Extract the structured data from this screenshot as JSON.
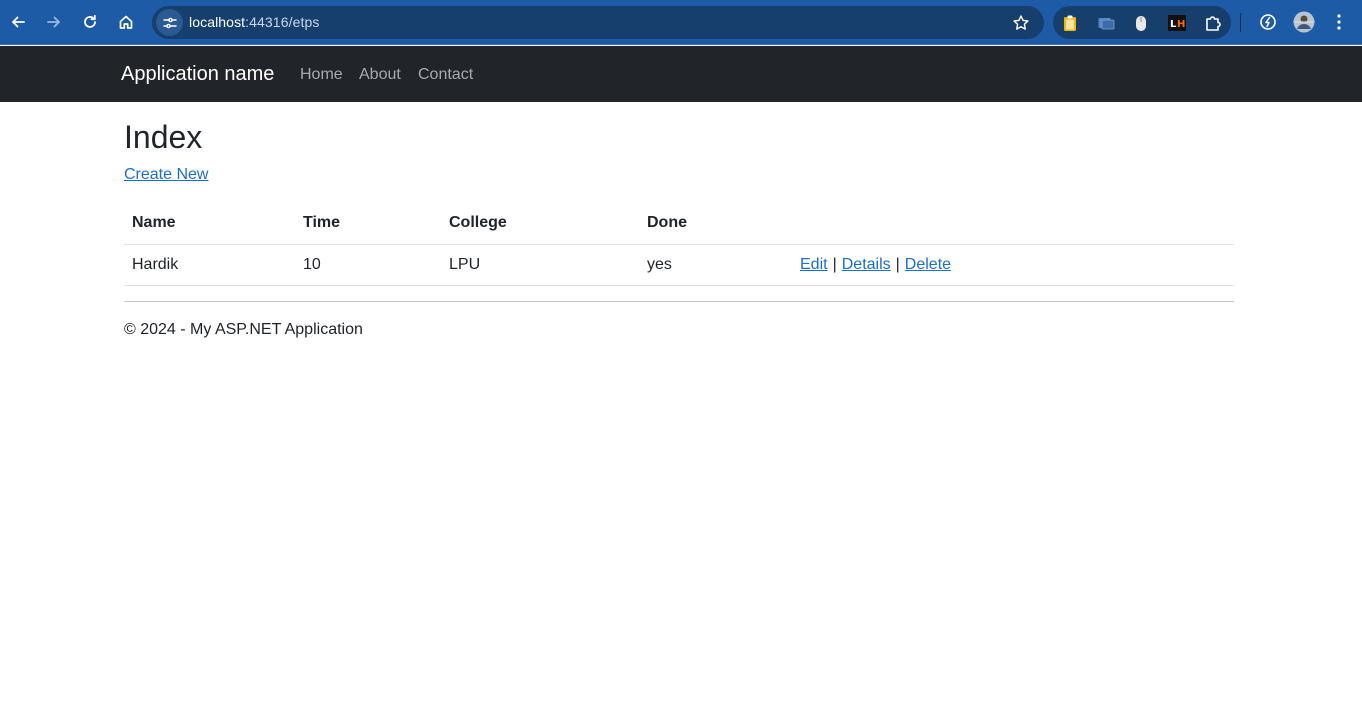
{
  "browser": {
    "url_host": "localhost",
    "url_rest": ":44316/etps",
    "theme_color": "#1d5ba7",
    "extensions": [
      "clipboard-extension-icon",
      "tab-extension-icon",
      "mouse-extension-icon",
      "lighthouse-extension-icon",
      "extensions-puzzle-icon"
    ]
  },
  "navbar": {
    "brand": "Application name",
    "links": [
      "Home",
      "About",
      "Contact"
    ],
    "background": "#212529"
  },
  "page": {
    "title": "Index",
    "create_link": "Create New"
  },
  "table": {
    "headers": [
      "Name",
      "Time",
      "College",
      "Done"
    ],
    "rows": [
      {
        "name": "Hardik",
        "time": "10",
        "college": "LPU",
        "done": "yes"
      }
    ],
    "actions": {
      "edit": "Edit",
      "details": "Details",
      "delete": "Delete",
      "separator": "|"
    }
  },
  "footer": {
    "text": "© 2024 - My ASP.NET Application"
  },
  "colors": {
    "link": "#1a6fd4",
    "text": "#212529"
  }
}
